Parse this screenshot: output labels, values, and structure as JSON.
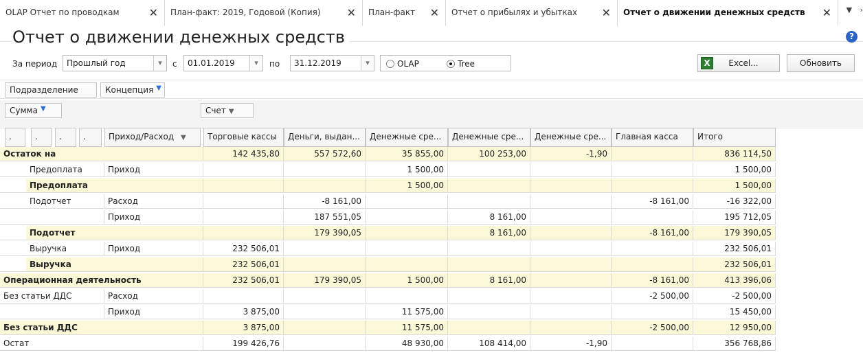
{
  "tabs": [
    {
      "label": "OLAP Отчет по проводкам",
      "active": false
    },
    {
      "label": "План-факт: 2019, Годовой (Копия)",
      "active": false
    },
    {
      "label": "План-факт",
      "active": false
    },
    {
      "label": "Отчет о прибылях и убытках",
      "active": false
    },
    {
      "label": "Отчет о движении денежных средств",
      "active": true
    }
  ],
  "tab_close_glyph": "✕",
  "tab_scroll": {
    "down": "▼",
    "more": "›"
  },
  "page": {
    "title": "Отчет о движении денежных средств",
    "help": "?"
  },
  "filters": {
    "period_label": "За период",
    "period_value": "Прошлый год",
    "from_label": "с",
    "from_value": "01.01.2019",
    "to_label": "по",
    "to_value": "31.12.2019",
    "view_options": [
      {
        "label": "OLAP",
        "selected": false
      },
      {
        "label": "Tree",
        "selected": true
      }
    ],
    "dropdown_glyph": "▾"
  },
  "toolbar": {
    "excel_label": "Excel...",
    "excel_icon": "excel-icon",
    "refresh_label": "Обновить"
  },
  "filter_chips": [
    {
      "label": "Подразделение",
      "filtered": false
    },
    {
      "label": "Концепция",
      "filtered": true
    }
  ],
  "data_chip": {
    "label": "Сумма",
    "filtered": true
  },
  "column_chip": {
    "label": "Счет",
    "dropdown": "▼"
  },
  "row_dims": [
    ".",
    ".",
    ".",
    "."
  ],
  "row_dim_main": {
    "label": "Приход/Расход",
    "dropdown": "▼"
  },
  "columns": [
    "Торговые кассы",
    "Деньги, выдан...",
    "Денежные сре...",
    "Денежные сре...",
    "Денежные сре...",
    "Главная касса",
    "Итого"
  ],
  "rows": [
    {
      "kind": "top",
      "l1": "Остаток на",
      "l2": "",
      "l3": "",
      "values": [
        "142 435,80",
        "557 572,60",
        "35 855,00",
        "100 253,00",
        "-1,90",
        "",
        "836 114,50"
      ]
    },
    {
      "kind": "plain",
      "l1": "",
      "l2": "Предоплата",
      "l3": "Приход",
      "values": [
        "",
        "",
        "1 500,00",
        "",
        "",
        "",
        "1 500,00"
      ]
    },
    {
      "kind": "sub",
      "l1": "",
      "l2": "Предоплата",
      "l3": "",
      "values": [
        "",
        "",
        "1 500,00",
        "",
        "",
        "",
        "1 500,00"
      ]
    },
    {
      "kind": "plain",
      "l1": "",
      "l2": "Подотчет",
      "l3": "Расход",
      "values": [
        "",
        "-8 161,00",
        "",
        "",
        "",
        "-8 161,00",
        "-16 322,00"
      ]
    },
    {
      "kind": "plain",
      "l1": "",
      "l2": "",
      "l3": "Приход",
      "values": [
        "",
        "187 551,05",
        "",
        "8 161,00",
        "",
        "",
        "195 712,05"
      ]
    },
    {
      "kind": "sub",
      "l1": "",
      "l2": "Подотчет",
      "l3": "",
      "values": [
        "",
        "179 390,05",
        "",
        "8 161,00",
        "",
        "-8 161,00",
        "179 390,05"
      ]
    },
    {
      "kind": "plain",
      "l1": "",
      "l2": "Выручка",
      "l3": "Приход",
      "values": [
        "232 506,01",
        "",
        "",
        "",
        "",
        "",
        "232 506,01"
      ]
    },
    {
      "kind": "sub",
      "l1": "",
      "l2": "Выручка",
      "l3": "",
      "values": [
        "232 506,01",
        "",
        "",
        "",
        "",
        "",
        "232 506,01"
      ]
    },
    {
      "kind": "top",
      "l1": "Операционная деятельность",
      "l2": "",
      "l3": "",
      "values": [
        "232 506,01",
        "179 390,05",
        "1 500,00",
        "8 161,00",
        "",
        "-8 161,00",
        "413 396,06"
      ]
    },
    {
      "kind": "plain",
      "l1": "Без статьи ДДС",
      "l2": "",
      "l3": "Расход",
      "values": [
        "",
        "",
        "",
        "",
        "",
        "-2 500,00",
        "-2 500,00"
      ]
    },
    {
      "kind": "plain",
      "l1": "",
      "l2": "",
      "l3": "Приход",
      "values": [
        "3 875,00",
        "",
        "11 575,00",
        "",
        "",
        "",
        "15 450,00"
      ]
    },
    {
      "kind": "top",
      "l1": "Без статьи ДДС",
      "l2": "",
      "l3": "",
      "values": [
        "3 875,00",
        "",
        "11 575,00",
        "",
        "",
        "-2 500,00",
        "12 950,00"
      ]
    },
    {
      "kind": "plainlast",
      "l1": "Остат",
      "l2": "",
      "l3": "",
      "values": [
        "199 426,76",
        "",
        "48 930,00",
        "108 414,00",
        "-1,90",
        "",
        "356 768,86"
      ]
    }
  ],
  "colors": {
    "subtotal_bg": "#fbf8d8",
    "accent": "#2d6fd6"
  }
}
